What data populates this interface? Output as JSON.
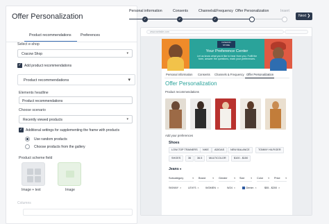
{
  "left": {
    "title": "Offer Personalization",
    "tabs": [
      "Product recommendations",
      "Preferences"
    ],
    "eshop_label": "Select e-shop",
    "eshop_value": "Cracow Shop",
    "add_reco_label": "Add product recommendations",
    "section_title": "Product recommendations",
    "headline_label": "Elements headline",
    "headline_value": "Product recommendations",
    "scenario_label": "Choose scenario",
    "scenario_value": "Recently viewed products",
    "additional_label": "Additional settings for supplementing the frame with products",
    "radio_random": "Use random products",
    "radio_gallery": "Choose products from the gallery",
    "scheme_label": "Product scheme field",
    "scheme_options": [
      "Image + text",
      "Image"
    ],
    "faded_label": "Columns"
  },
  "steps": {
    "items": [
      {
        "label": "Personal information",
        "state": "done"
      },
      {
        "label": "Consents",
        "state": "done"
      },
      {
        "label": "Channels&Frequency",
        "state": "done"
      },
      {
        "label": "Offer Personalization",
        "state": "current"
      },
      {
        "label": "Insert",
        "state": "upcoming"
      }
    ],
    "check": "✓",
    "next_label": "Next",
    "next_arrow": "❯"
  },
  "preview": {
    "url": "www.website.com",
    "brand_line1": "FASHION",
    "brand_line2": "STORE",
    "banner_title": "Your Preference Center",
    "banner_sub": "Let us know what you'd like to hear from you. Fulfil the form, answer the questions, mark your preferences.",
    "tabs": [
      "Personal information",
      "Consents",
      "Channels & Frequency",
      "Offer Personalization"
    ],
    "title": "Offer Personalization",
    "reco_label": "Product recommendations",
    "pref_label": "Add your preferences",
    "shoes_title": "Shoes",
    "shoes_row1": [
      "LOW-TOP TRAINERS",
      "NIKE",
      "ADIDAS",
      "NEW BALANCE",
      "TOMMY HILFIGER"
    ],
    "shoes_row2": [
      "SHOES",
      "36",
      "36.5",
      "MULTICOLOR",
      "$100 - $150"
    ],
    "jeans_title": "Jeans",
    "jeans_filters": [
      "Subcategory",
      "Brand",
      "Gender",
      "Size",
      "Color",
      "Price"
    ],
    "jeans_tags": [
      "SKINNY",
      "LEVI'S",
      "WOMEN",
      "W24",
      "Denim",
      "$55 - $200"
    ],
    "remove_glyph": "×",
    "chevron": "▾"
  },
  "colors": {
    "accent": "#2aa39a",
    "primary": "#2d3a4e",
    "link": "#3b6fb5"
  }
}
